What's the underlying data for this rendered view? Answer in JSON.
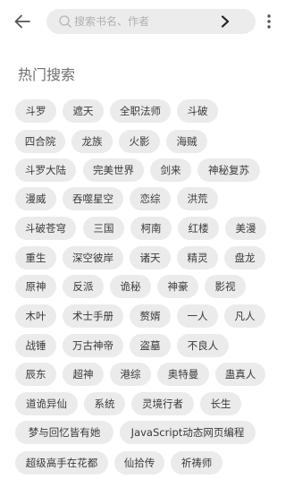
{
  "search": {
    "placeholder": "搜索书名、作者",
    "value": ""
  },
  "section_title": "热门搜索",
  "tags": [
    "斗罗",
    "遮天",
    "全职法师",
    "斗破",
    "四合院",
    "龙族",
    "火影",
    "海贼",
    "斗罗大陆",
    "完美世界",
    "剑来",
    "神秘复苏",
    "漫威",
    "吞噬星空",
    "恋综",
    "洪荒",
    "斗破苍穹",
    "三国",
    "柯南",
    "红楼",
    "美漫",
    "重生",
    "深空彼岸",
    "诸天",
    "精灵",
    "盘龙",
    "原神",
    "反派",
    "诡秘",
    "神豪",
    "影视",
    "木叶",
    "术士手册",
    "赘婿",
    "一人",
    "凡人",
    "战锤",
    "万古神帝",
    "盗墓",
    "不良人",
    "辰东",
    "超神",
    "港综",
    "奥特曼",
    "蛊真人",
    "道诡异仙",
    "系统",
    "灵境行者",
    "长生",
    "梦与回忆皆有她",
    "JavaScript动态网页编程",
    "超级高手在花都",
    "仙拾传",
    "祈祷师"
  ]
}
